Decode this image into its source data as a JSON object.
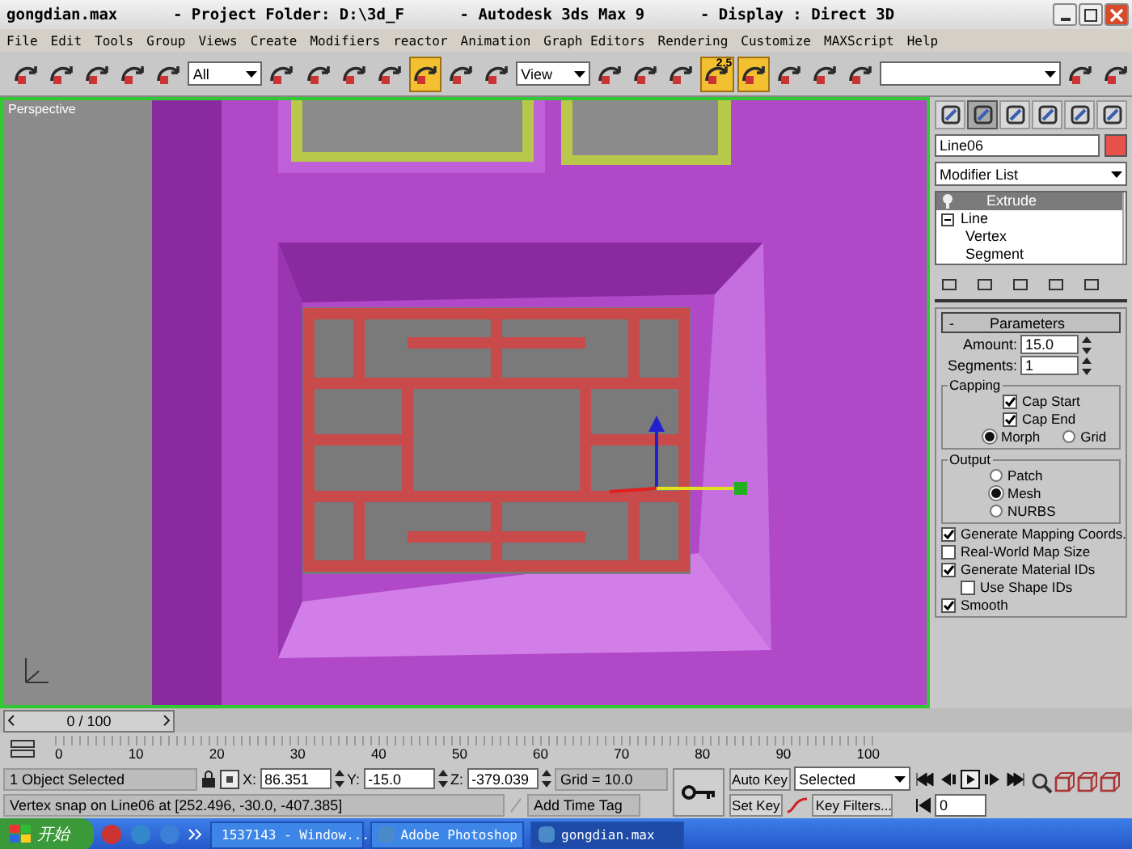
{
  "window": {
    "title": "gongdian.max      - Project Folder: D:\\3d_F      - Autodesk 3ds Max 9      - Display : Direct 3D"
  },
  "menu": [
    "File",
    "Edit",
    "Tools",
    "Group",
    "Views",
    "Create",
    "Modifiers",
    "reactor",
    "Animation",
    "Graph Editors",
    "Rendering",
    "Customize",
    "MAXScript",
    "Help"
  ],
  "toolbar": [
    {
      "kind": "button",
      "on": false
    },
    {
      "kind": "button",
      "on": false
    },
    {
      "kind": "button",
      "on": false
    },
    {
      "kind": "button",
      "on": false
    },
    {
      "kind": "button",
      "on": false
    },
    {
      "kind": "dropdown",
      "value": "All"
    },
    {
      "kind": "button",
      "on": false
    },
    {
      "kind": "button",
      "on": false
    },
    {
      "kind": "button",
      "on": false
    },
    {
      "kind": "button",
      "on": false
    },
    {
      "kind": "button",
      "on": true
    },
    {
      "kind": "button",
      "on": false
    },
    {
      "kind": "button",
      "on": false
    },
    {
      "kind": "dropdown",
      "value": "View"
    },
    {
      "kind": "button",
      "on": false
    },
    {
      "kind": "button",
      "on": false
    },
    {
      "kind": "button",
      "on": false
    },
    {
      "kind": "button",
      "on": true,
      "label": "2.5"
    },
    {
      "kind": "button",
      "on": true
    },
    {
      "kind": "button",
      "on": false
    },
    {
      "kind": "button",
      "on": false
    },
    {
      "kind": "button",
      "on": false
    },
    {
      "kind": "dropdown"
    },
    {
      "kind": "button",
      "on": false
    },
    {
      "kind": "button",
      "on": false
    }
  ],
  "viewport": {
    "label": "Perspective"
  },
  "command_panel": {
    "tabs": [
      {
        "selected": false
      },
      {
        "selected": true
      },
      {
        "selected": false
      },
      {
        "selected": false
      },
      {
        "selected": false
      },
      {
        "selected": false
      }
    ],
    "object_name": "Line06",
    "modifier_list": "Modifier List",
    "modifier_stack": [
      {
        "label": "Extrude",
        "selected": true
      },
      {
        "label": "Line",
        "selected": false,
        "expanded": true,
        "children": [
          {
            "label": "Vertex",
            "selected": false
          },
          {
            "label": "Segment",
            "selected": false
          }
        ]
      }
    ],
    "rollout": {
      "toggle": "-",
      "title": "Parameters",
      "amount": {
        "label": "Amount:",
        "value": "15.0"
      },
      "segments": {
        "label": "Segments:",
        "value": "1"
      },
      "capping": {
        "title": "Capping",
        "checks": [
          {
            "label": "Cap Start",
            "checked": true
          },
          {
            "label": "Cap End",
            "checked": true
          }
        ],
        "options": [
          {
            "label": "Morph",
            "selected": true
          },
          {
            "label": "Grid",
            "selected": false
          }
        ]
      },
      "output": {
        "title": "Output",
        "options": [
          {
            "label": "Patch",
            "selected": false
          },
          {
            "label": "Mesh",
            "selected": true
          },
          {
            "label": "NURBS",
            "selected": false
          }
        ]
      },
      "checks": [
        {
          "label": "Generate Mapping Coords.",
          "checked": true
        },
        {
          "label": "Real-World Map Size",
          "checked": false
        },
        {
          "label": "Generate Material IDs",
          "checked": true,
          "children": [
            {
              "label": "Use Shape IDs",
              "checked": false
            }
          ]
        },
        {
          "label": "Smooth",
          "checked": true
        }
      ]
    }
  },
  "time_slider": {
    "position": "0 / 100",
    "level": 0,
    "ticks": [
      "0",
      "10",
      "20",
      "30",
      "40",
      "50",
      "60",
      "70",
      "80",
      "90",
      "100"
    ]
  },
  "status": {
    "selection": "1 Object Selected",
    "x": {
      "label": "X:",
      "value": "86.351"
    },
    "y": {
      "label": "Y:",
      "value": "-15.0"
    },
    "z": {
      "label": "Z:",
      "value": "-379.039"
    },
    "grid": "Grid = 10.0",
    "prompt": "Vertex snap on Line06 at [252.496, -30.0, -407.385]",
    "time_tag": "Add Time Tag",
    "auto_key": "Auto Key",
    "key_mode": "Selected",
    "set_key": "Set Key",
    "key_filters": "Key Filters...",
    "frame": "0"
  },
  "taskbar": {
    "start": "开始",
    "tasks": [
      {
        "label": "1537143 - Window...",
        "selected": false
      },
      {
        "label": "Adobe Photoshop",
        "selected": false
      },
      {
        "label": "gongdian.max",
        "selected": true
      }
    ]
  }
}
